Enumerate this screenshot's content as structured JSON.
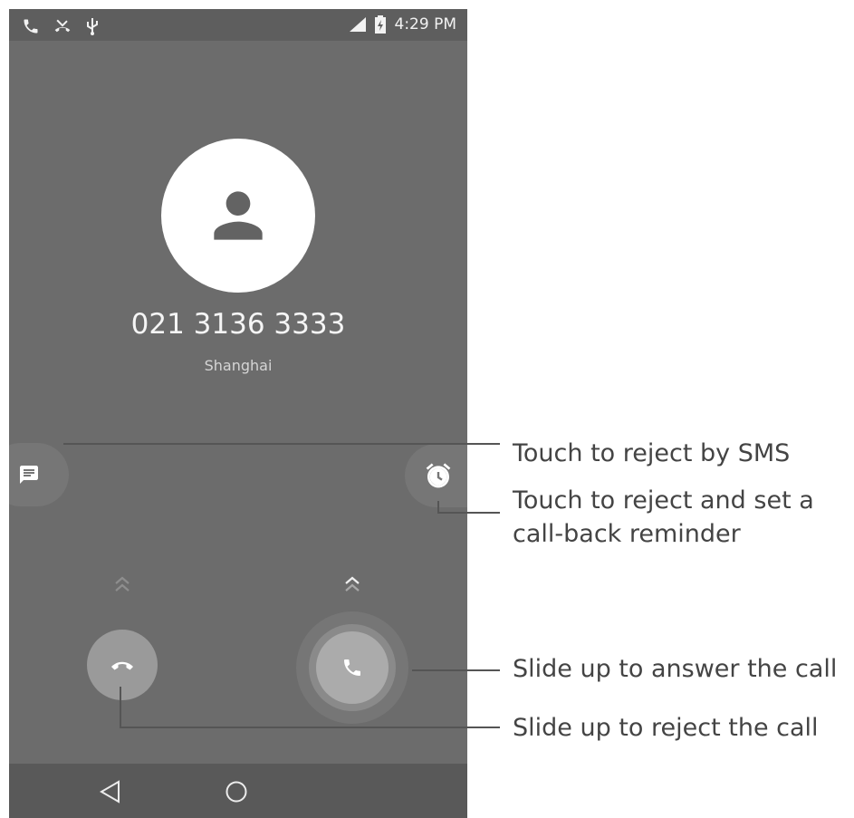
{
  "status_bar": {
    "time": "4:29 PM",
    "left_icons": [
      "phone-icon",
      "missed-call-icon",
      "usb-icon"
    ],
    "right_icons": [
      "signal-icon",
      "battery-charging-icon"
    ]
  },
  "caller": {
    "number": "021 3136 3333",
    "location": "Shanghai",
    "avatar_icon": "person-icon"
  },
  "actions": {
    "sms_icon": "message-icon",
    "reminder_icon": "alarm-icon",
    "decline_icon": "end-call-icon",
    "answer_icon": "phone-icon"
  },
  "navigation": {
    "back_icon": "back-triangle-icon",
    "home_icon": "home-circle-icon"
  },
  "annotations": {
    "sms": "Touch to reject by SMS",
    "reminder_line1": "Touch to reject and set a",
    "reminder_line2": "call-back reminder",
    "answer": "Slide up to answer the call",
    "reject": "Slide up to reject the call"
  },
  "colors": {
    "screen_background": "#6c6c6c",
    "status_bar": "#5e5e5e",
    "navigation_bar": "#595959",
    "annotation_text": "#444444"
  }
}
